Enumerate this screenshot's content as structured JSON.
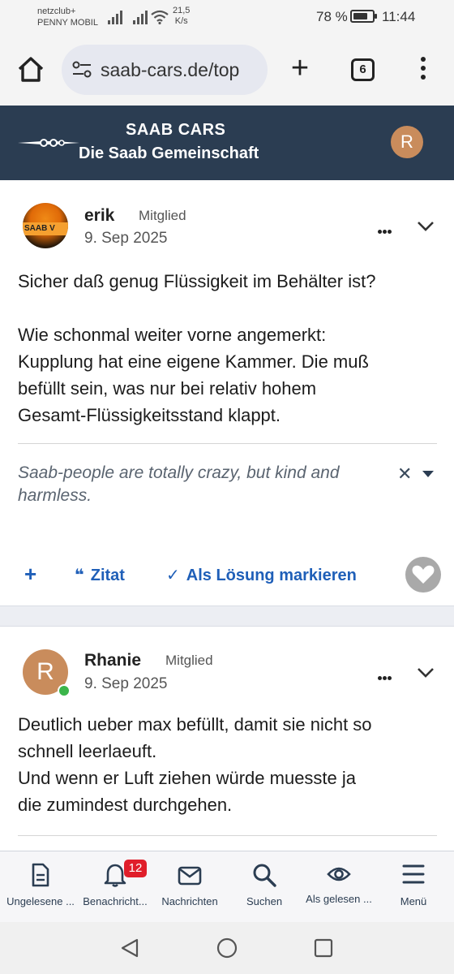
{
  "status_bar": {
    "carrier_line1": "netzclub+",
    "carrier_line2": "PENNY MOBIL",
    "speed_value": "21,5",
    "speed_unit": "K/s",
    "battery_percent": "78 %",
    "battery_level": 0.78,
    "time": "11:44"
  },
  "browser": {
    "url": "saab-cars.de/top",
    "tab_count": "6"
  },
  "site": {
    "title_line1": "SAAB CARS",
    "title_line2": "Die Saab Gemeinschaft",
    "user_initial": "R",
    "brand_color": "#2b3d52",
    "avatar_color": "#c98c5c"
  },
  "posts": [
    {
      "author": "erik",
      "role": "Mitglied",
      "date": "9. Sep 2025",
      "avatar_text": "SAAB V",
      "body": [
        "Sicher daß genug Flüssigkeit im Behälter ist?",
        "Wie schonmal weiter vorne angemerkt:",
        "Kupplung hat eine eigene Kammer. Die muß",
        "befüllt sein, was nur bei relativ hohem",
        "Gesamt-Flüssigkeitsstand klappt."
      ],
      "signature": "Saab-people are totally crazy, but kind and harmless.",
      "actions": {
        "add": "+",
        "quote": "Zitat",
        "solution": "Als Lösung markieren"
      }
    },
    {
      "author": "Rhanie",
      "role": "Mitglied",
      "date": "9. Sep 2025",
      "avatar_initial": "R",
      "online": true,
      "body": [
        "Deutlich ueber max befüllt, damit sie nicht so",
        "schnell leerlaeuft.",
        "Und wenn er Luft ziehen würde muesste ja",
        "die zumindest durchgehen."
      ]
    }
  ],
  "bottom_nav": {
    "items": [
      {
        "label": "Ungelesene ...",
        "icon": "document-icon"
      },
      {
        "label": "Benachricht...",
        "icon": "bell-icon",
        "badge": "12"
      },
      {
        "label": "Nachrichten",
        "icon": "envelope-icon"
      },
      {
        "label": "Suchen",
        "icon": "search-icon"
      },
      {
        "label": "Als gelesen ...",
        "icon": "eye-icon"
      },
      {
        "label": "Menü",
        "icon": "hamburger-icon"
      }
    ]
  }
}
